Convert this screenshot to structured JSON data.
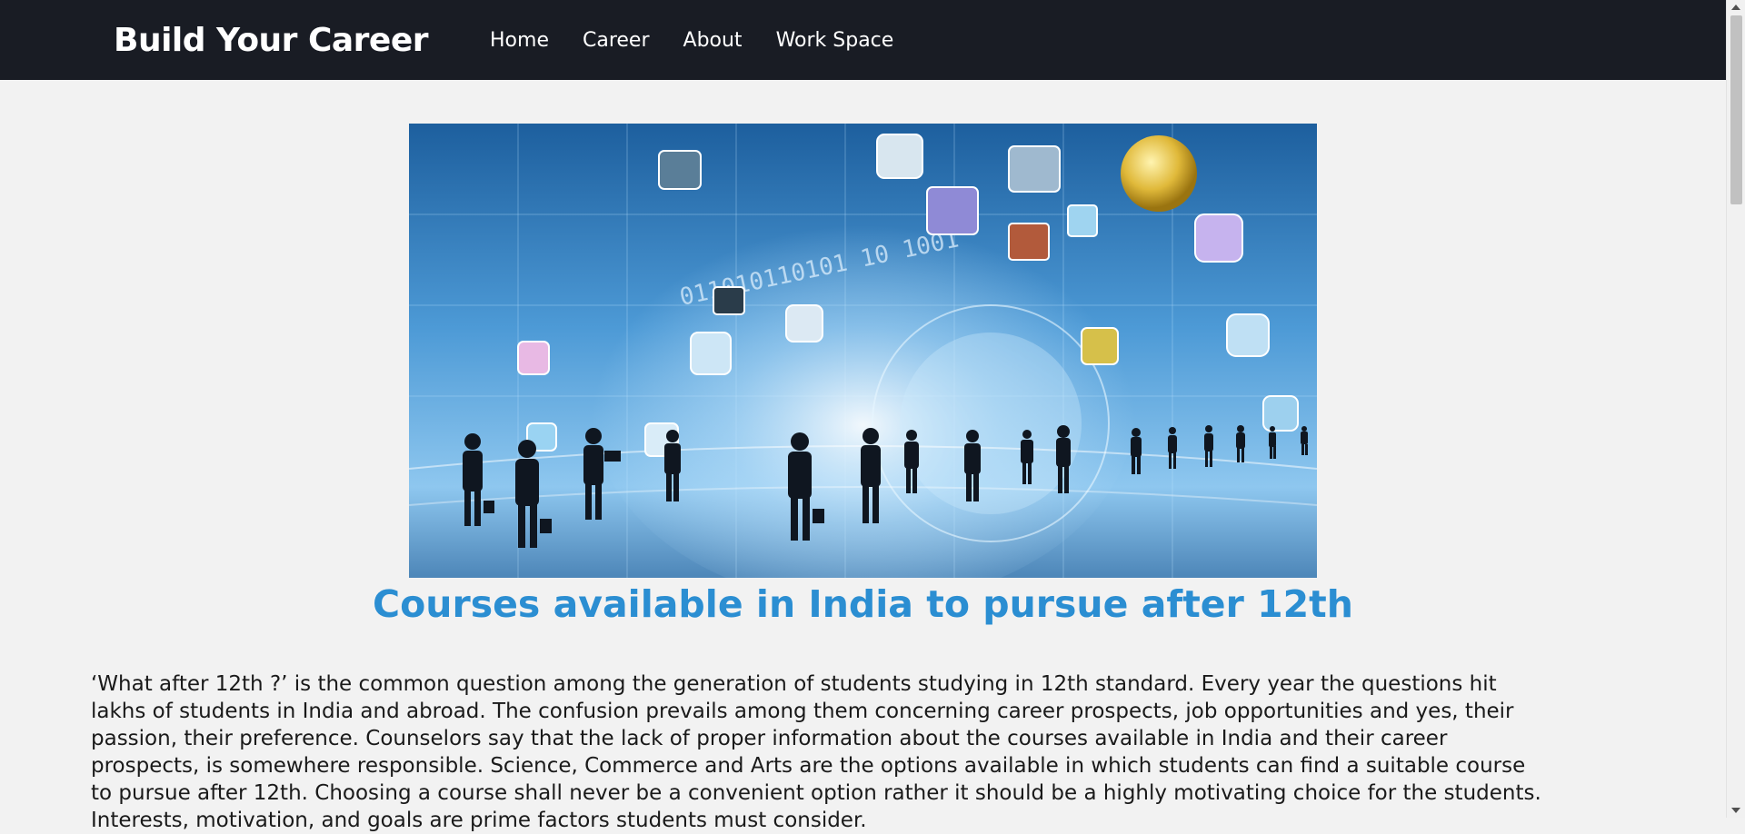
{
  "navbar": {
    "brand": "Build Your Career",
    "links": [
      "Home",
      "Career",
      "About",
      "Work Space"
    ]
  },
  "hero_image": {
    "description_icon": "career-globe-illustration",
    "binary_text": "011010110101 10 1001"
  },
  "main": {
    "headline": "Courses available in India to pursue after 12th",
    "intro": "‘What after 12th ?’ is the common question among the generation of students studying in 12th standard. Every year the questions hit lakhs of students in India and abroad. The confusion prevails among them concerning career prospects, job opportunities and yes, their passion, their preference. Counselors say that the lack of proper information about the courses available in India and their career prospects, is somewhere responsible. Science, Commerce and Arts are the options available in which students can find a suitable course to pursue after 12th. Choosing a course shall never be a convenient option rather it should be a highly motivating choice for the students. Interests, motivation, and goals are prime factors students must consider."
  },
  "colors": {
    "navbar_bg": "#191c24",
    "headline": "#2b8ed2",
    "page_bg": "#f2f2f2"
  }
}
